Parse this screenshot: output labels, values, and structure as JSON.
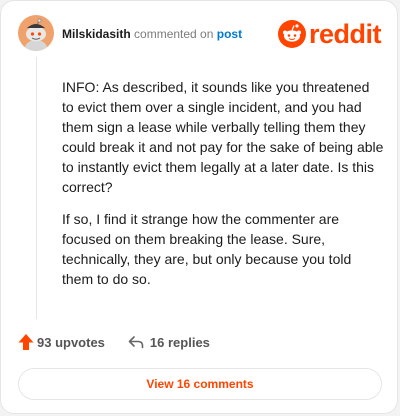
{
  "header": {
    "username": "Milskidasith",
    "commented_text": "commented on",
    "post_link": "post"
  },
  "logo": {
    "word": "reddit",
    "icon": "reddit-snoo-icon",
    "color": "#ff4500"
  },
  "avatar": {
    "icon": "snoo-avatar-icon",
    "bg_color": "#f0a26c"
  },
  "comment": {
    "paragraphs": [
      "INFO: As described, it sounds like you threatened to evict them over a single incident, and you had them sign a lease while verbally telling them they could break it and not pay for the sake of being able to instantly evict them legally at a later date. Is this correct?",
      "If so, I find it strange how the commenter are focused on them breaking the lease. Sure, technically, they are, but only because you told them to do so."
    ]
  },
  "actions": {
    "upvotes": "93 upvotes",
    "upvote_icon": "upvote-arrow-icon",
    "upvote_color": "#ff4500",
    "replies": "16 replies",
    "reply_icon": "reply-arrow-icon"
  },
  "view_button": {
    "label": "View 16 comments"
  }
}
